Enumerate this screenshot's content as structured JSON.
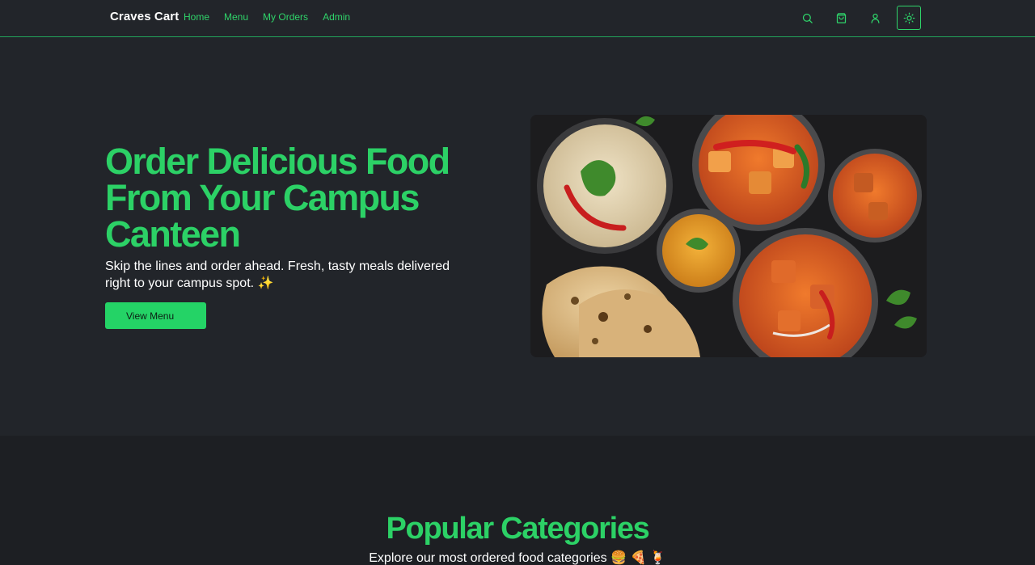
{
  "header": {
    "brand": "Craves Cart",
    "nav": [
      {
        "label": "Home"
      },
      {
        "label": "Menu"
      },
      {
        "label": "My Orders"
      },
      {
        "label": "Admin"
      }
    ],
    "icons": [
      "search-icon",
      "cart-icon",
      "user-icon",
      "sun-icon"
    ]
  },
  "hero": {
    "title": "Order Delicious Food From Your Campus Canteen",
    "subtitle": "Skip the lines and order ahead. Fresh, tasty meals delivered right to your campus spot. ✨",
    "cta_label": "View Menu"
  },
  "categories": {
    "title": "Popular Categories",
    "subtitle": "Explore our most ordered food categories 🍔 🍕 🍹"
  },
  "colors": {
    "accent": "#2cd166",
    "background": "#22252a",
    "section_background": "#1d1f23"
  }
}
